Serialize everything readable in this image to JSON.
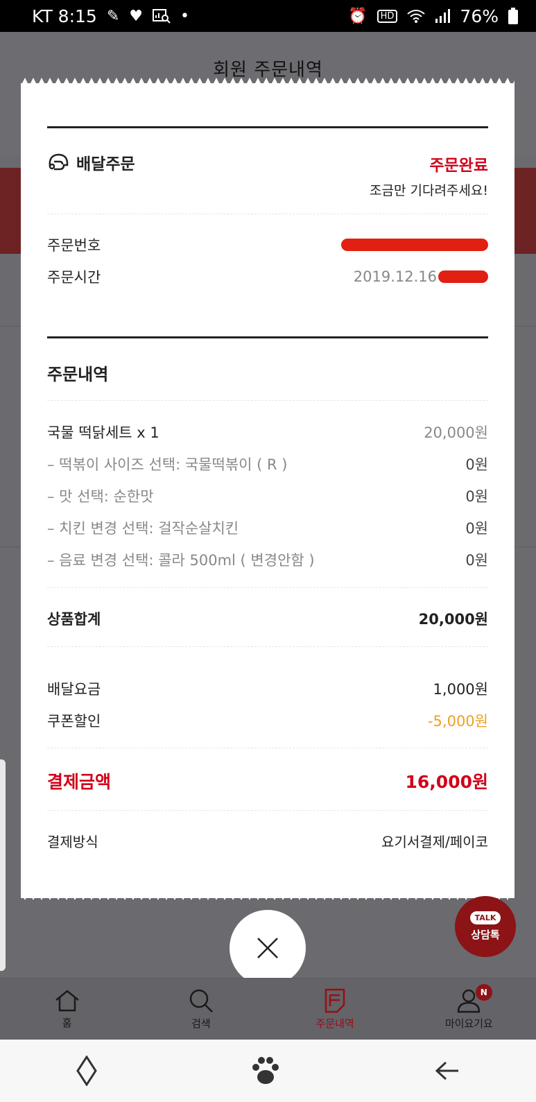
{
  "status_bar": {
    "carrier_time": "KT 8:15",
    "battery": "76%"
  },
  "page": {
    "title": "회원 주문내역"
  },
  "receipt": {
    "order_type": "배달주문",
    "status": "주문완료",
    "status_message": "조금만 기다려주세요!",
    "order_number_label": "주문번호",
    "order_time_label": "주문시간",
    "order_time_value": "2019.12.16",
    "order_details_title": "주문내역",
    "items": [
      {
        "name": "국물 떡닭세트 x 1",
        "price": "20,000원"
      },
      {
        "name": "– 떡볶이 사이즈 선택: 국물떡볶이 ( R )",
        "price": "0원"
      },
      {
        "name": "– 맛 선택: 순한맛",
        "price": "0원"
      },
      {
        "name": "– 치킨 변경 선택: 걸작순살치킨",
        "price": "0원"
      },
      {
        "name": "– 음료 변경 선택: 콜라 500ml ( 변경안함 )",
        "price": "0원"
      }
    ],
    "subtotal_label": "상품합계",
    "subtotal_value": "20,000원",
    "delivery_fee_label": "배달요금",
    "delivery_fee_value": "1,000원",
    "coupon_label": "쿠폰할인",
    "coupon_value": "-5,000원",
    "total_label": "결제금액",
    "total_value": "16,000원",
    "payment_method_label": "결제방식",
    "payment_method_value": "요기서결제/페이코"
  },
  "talk_button": {
    "bubble": "TALK",
    "label": "상담톡"
  },
  "bottom_nav": {
    "items": [
      {
        "label": "홈",
        "icon": "home-icon"
      },
      {
        "label": "검색",
        "icon": "search-icon"
      },
      {
        "label": "주문내역",
        "icon": "order-list-icon"
      },
      {
        "label": "마이요기요",
        "icon": "profile-icon"
      }
    ],
    "badge": "N"
  },
  "colors": {
    "accent_red": "#d0021b",
    "discount_orange": "#f0a020",
    "brand_dark_red": "#8c1316"
  }
}
